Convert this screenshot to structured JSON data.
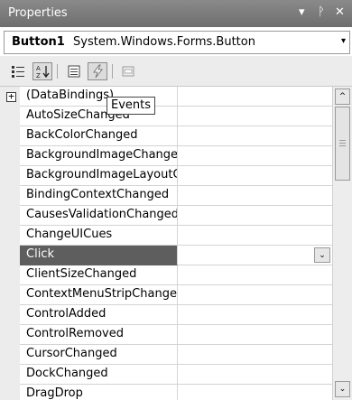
{
  "window": {
    "title": "Properties",
    "controls": {
      "dropdown": "▾",
      "pin": "ᚹ",
      "close": "✕"
    }
  },
  "object_selector": {
    "name": "Button1",
    "type": "System.Windows.Forms.Button",
    "dropdown_glyph": "▾"
  },
  "toolbar": {
    "buttons": [
      {
        "icon": "categorized-icon",
        "glyph": "☷"
      },
      {
        "icon": "alphabetical-icon",
        "glyph": "A↓",
        "active": true
      },
      {
        "icon": "properties-icon",
        "glyph": "▤"
      },
      {
        "icon": "events-icon",
        "glyph": "⚡",
        "active": true
      },
      {
        "icon": "property-pages-icon",
        "glyph": "▭"
      }
    ]
  },
  "tooltip": {
    "text": "Events"
  },
  "rows": [
    {
      "name": "(DataBindings)",
      "expander": "+"
    },
    {
      "name": "AutoSizeChanged"
    },
    {
      "name": "BackColorChanged"
    },
    {
      "name": "BackgroundImageChanged"
    },
    {
      "name": "BackgroundImageLayoutCh"
    },
    {
      "name": "BindingContextChanged"
    },
    {
      "name": "CausesValidationChanged"
    },
    {
      "name": "ChangeUICues"
    },
    {
      "name": "Click",
      "selected": true,
      "dropdown_glyph": "⌄"
    },
    {
      "name": "ClientSizeChanged"
    },
    {
      "name": "ContextMenuStripChanged"
    },
    {
      "name": "ControlAdded"
    },
    {
      "name": "ControlRemoved"
    },
    {
      "name": "CursorChanged"
    },
    {
      "name": "DockChanged"
    },
    {
      "name": "DragDrop"
    }
  ],
  "scrollbar": {
    "up_glyph": "^",
    "down_glyph": "⌄"
  }
}
